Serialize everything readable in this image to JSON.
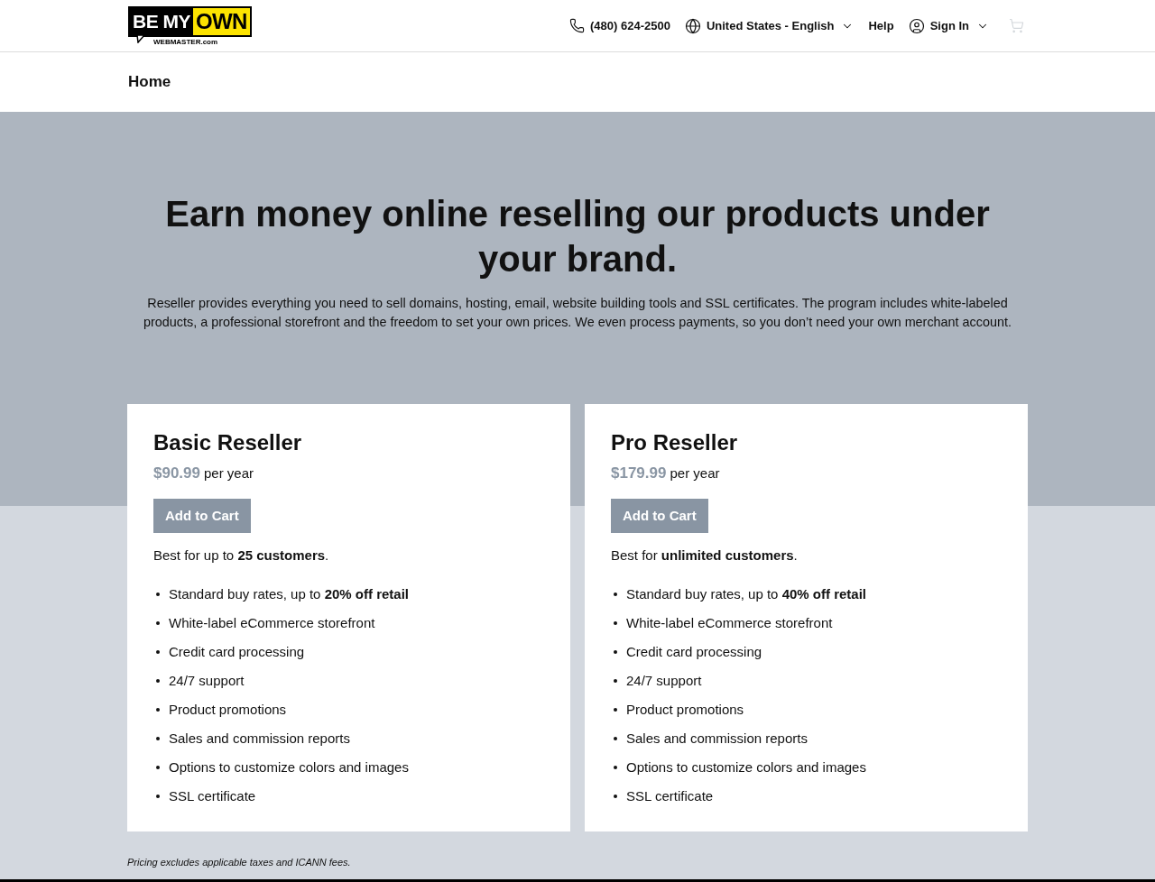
{
  "header": {
    "logo": {
      "dark_part": "BE MY",
      "light_part": "OWN",
      "subtitle": "WEBMASTER.com"
    },
    "phone": "(480) 624-2500",
    "language": "United States - English",
    "help": "Help",
    "sign_in": "Sign In"
  },
  "breadcrumb": [
    "Home"
  ],
  "hero": {
    "title": "Earn money online reselling our products under your brand.",
    "description": "Reseller provides everything you need to sell domains, hosting, email, website building tools and SSL certificates. The program includes white-labeled products, a professional storefront and the freedom to set your own prices. We even process payments, so you don’t need your own merchant account."
  },
  "plans": [
    {
      "name": "Basic Reseller",
      "price": "$90.99",
      "period": "per year",
      "button": "Add to Cart",
      "summary": "Best for up to **25 customers**.",
      "features": [
        "Standard buy rates, up to **20% off retail**",
        "White-label eCommerce storefront",
        "Credit card processing",
        "24/7 support",
        "Product promotions",
        "Sales and commission reports",
        "Options to customize colors and images",
        "SSL certificate"
      ]
    },
    {
      "name": "Pro Reseller",
      "price": "$179.99",
      "period": "per year",
      "button": "Add to Cart",
      "summary": "Best for **unlimited customers**.",
      "features": [
        "Standard buy rates, up to **40% off retail**",
        "White-label eCommerce storefront",
        "Credit card processing",
        "24/7 support",
        "Product promotions",
        "Sales and commission reports",
        "Options to customize colors and images",
        "SSL certificate"
      ]
    }
  ],
  "footnote": "Pricing excludes applicable taxes and ICANN fees."
}
